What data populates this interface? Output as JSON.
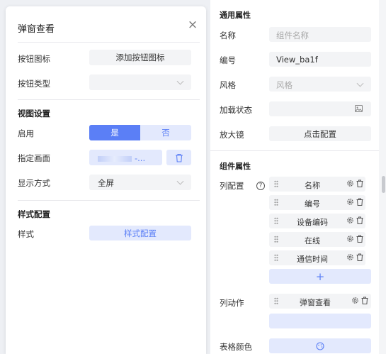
{
  "popup": {
    "title": "弹窗查看",
    "close_glyph": "×",
    "button_icon_label": "按钮图标",
    "button_icon_action": "添加按钮图标",
    "button_type_label": "按钮类型",
    "button_type_value": "",
    "view_section": "视图设置",
    "enable_label": "启用",
    "enable_yes": "是",
    "enable_no": "否",
    "target_label": "指定画面",
    "target_value_suffix": "-...",
    "display_label": "显示方式",
    "display_value": "全屏",
    "style_section": "样式配置",
    "style_label": "样式",
    "style_button": "样式配置"
  },
  "panel": {
    "general_section": "通用属性",
    "name_label": "名称",
    "name_placeholder": "组件名称",
    "id_label": "编号",
    "id_value": "View_ba1f",
    "theme_label": "风格",
    "theme_placeholder": "风格",
    "loading_label": "加载状态",
    "magnifier_label": "放大镜",
    "magnifier_button": "点击配置",
    "component_section": "组件属性",
    "columns_label": "列配置",
    "help_glyph": "?",
    "columns": [
      {
        "name": "名称"
      },
      {
        "name": "编号"
      },
      {
        "name": "设备编码"
      },
      {
        "name": "在线"
      },
      {
        "name": "通信时间"
      }
    ],
    "add_glyph": "+",
    "actions_label": "列动作",
    "actions": [
      {
        "name": "弹窗查看"
      }
    ],
    "table_color_label": "表格颜色"
  },
  "colors": {
    "accent": "#5b7ff6",
    "accent_light": "#e3e9fd",
    "control_bg": "#f3f4f6"
  }
}
